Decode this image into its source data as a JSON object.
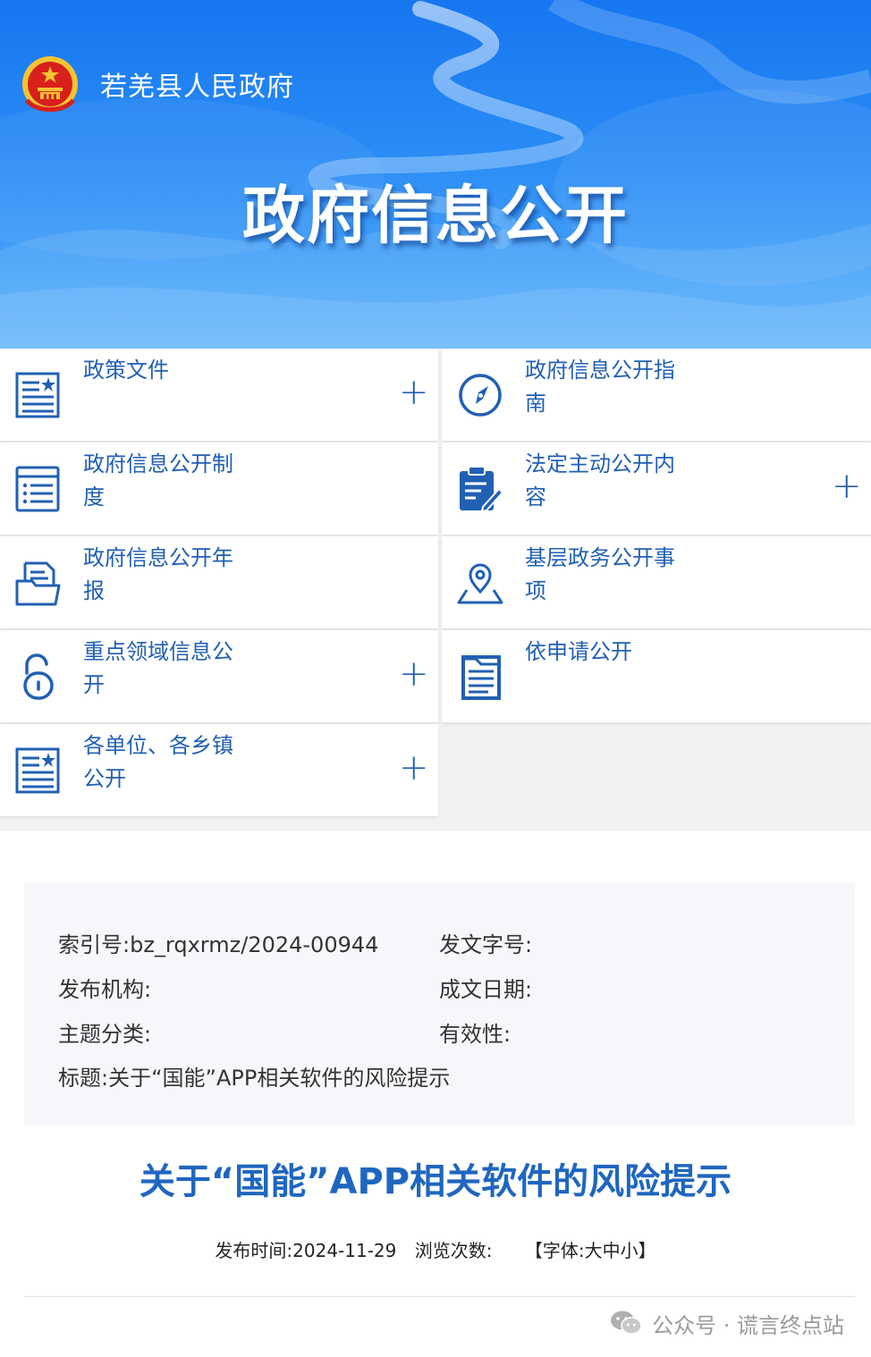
{
  "header": {
    "gov_name": "若羌县人民政府",
    "hero_title": "政府信息公开"
  },
  "nav": {
    "items": [
      {
        "label": "政策文件",
        "icon": "policy-document-icon",
        "expandable": true
      },
      {
        "label": "政府信息公开指南",
        "icon": "compass-icon",
        "expandable": false
      },
      {
        "label": "政府信息公开制度",
        "icon": "list-icon",
        "expandable": false
      },
      {
        "label": "法定主动公开内容",
        "icon": "clipboard-edit-icon",
        "expandable": true
      },
      {
        "label": "政府信息公开年报",
        "icon": "folder-document-icon",
        "expandable": false
      },
      {
        "label": "基层政务公开事项",
        "icon": "location-map-icon",
        "expandable": false
      },
      {
        "label": "重点领域信息公开",
        "icon": "unlock-icon",
        "expandable": true
      },
      {
        "label": "依申请公开",
        "icon": "application-form-icon",
        "expandable": false
      },
      {
        "label": "各单位、各乡镇公开",
        "icon": "policy-document-icon",
        "expandable": true
      }
    ],
    "plus_symbol": "+"
  },
  "info": {
    "index_label": "索引号:",
    "index_value": "bz_rqxrmz/2024-00944",
    "doc_number_label": "发文字号:",
    "doc_number_value": "",
    "issuer_label": "发布机构:",
    "issuer_value": "",
    "written_date_label": "成文日期:",
    "written_date_value": "",
    "topic_label": "主题分类:",
    "topic_value": "",
    "validity_label": "有效性:",
    "validity_value": "",
    "title_label": "标题:",
    "title_value": "关于“国能”APP相关软件的风险提示"
  },
  "article": {
    "title": "关于“国能”APP相关软件的风险提示",
    "publish_label": "发布时间:",
    "publish_date": "2024-11-29",
    "views_label": "浏览次数:",
    "views_value": "",
    "font_open": "【字体:",
    "font_large": "大",
    "font_medium": "中",
    "font_small": "小",
    "font_close": "】"
  },
  "watermark": {
    "text": "公众号 · 谎言终点站",
    "icon": "wechat-icon"
  },
  "colors": {
    "accent": "#2160b3",
    "title_blue": "#1f66c0",
    "banner_blue": "#1676f0"
  }
}
